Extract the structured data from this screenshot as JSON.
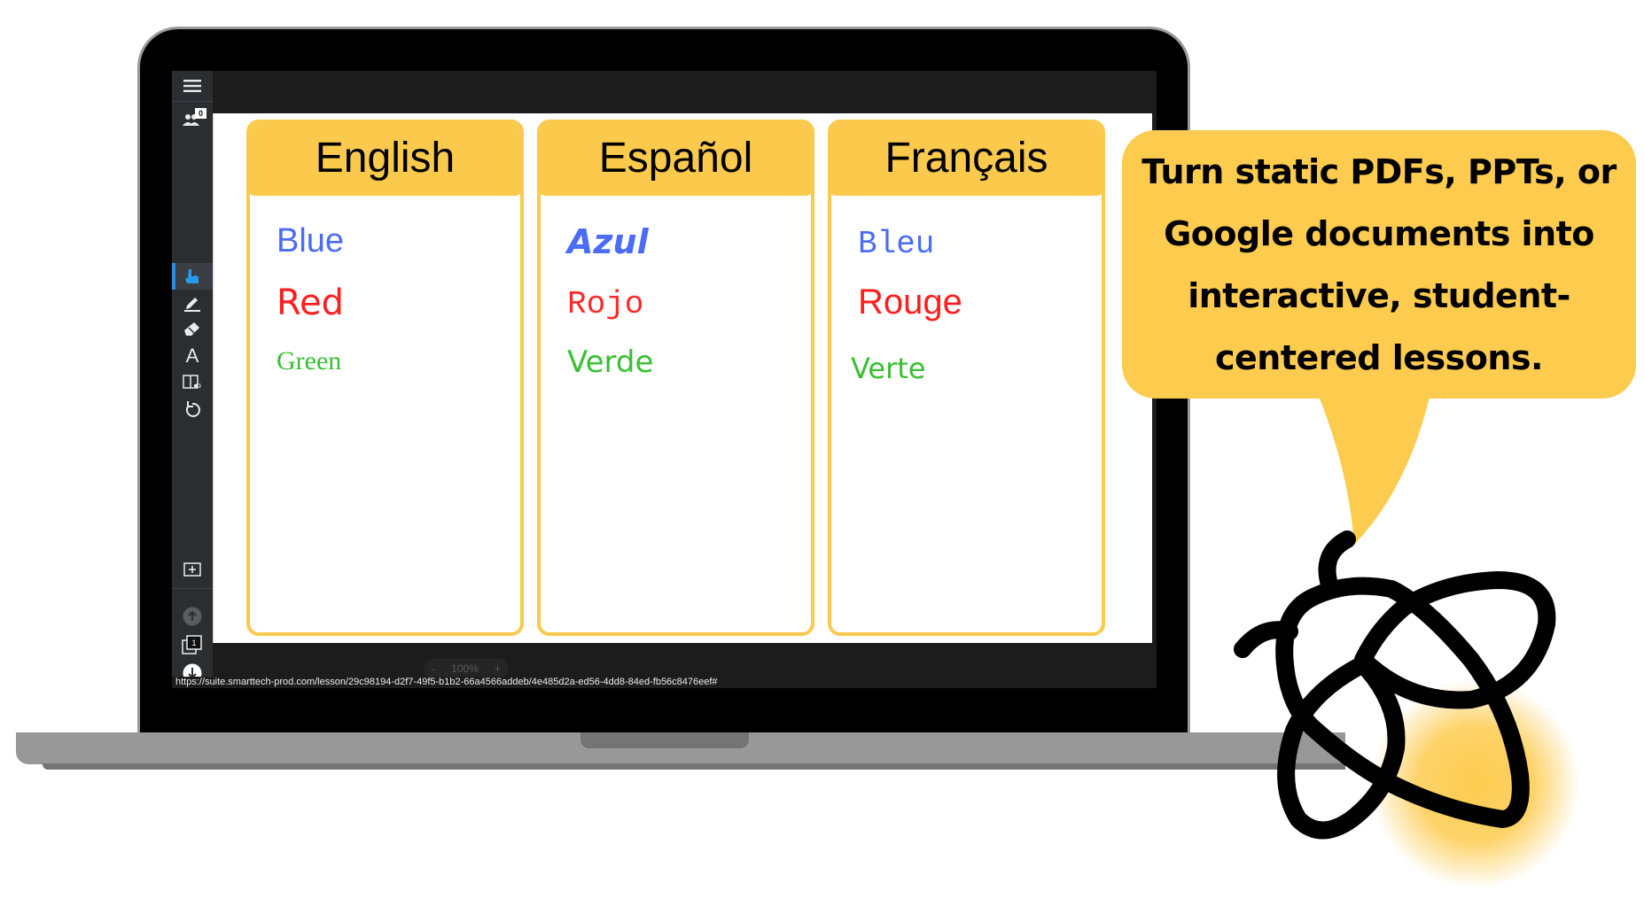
{
  "sidebar": {
    "participants_count": "0",
    "page_number": "1",
    "icons": [
      "menu-icon",
      "participants-icon",
      "select-hand-icon",
      "pen-icon",
      "eraser-icon",
      "text-icon",
      "read-aloud-icon",
      "undo-icon",
      "add-page-icon",
      "previous-page-icon",
      "pages-icon",
      "next-page-icon"
    ],
    "active_tool": "select-hand-icon",
    "active_color": "#2a8fe0"
  },
  "canvas": {
    "cards": [
      {
        "title": "English",
        "words": [
          {
            "text": "Blue",
            "color": "#4a6cf7"
          },
          {
            "text": "Red",
            "color": "#ff1f1f"
          },
          {
            "text": "Green",
            "color": "#39c032"
          }
        ]
      },
      {
        "title": "Español",
        "words": [
          {
            "text": "Azul",
            "color": "#4a6cf7"
          },
          {
            "text": "Rojo",
            "color": "#ff2a2a"
          },
          {
            "text": "Verde",
            "color": "#39c032"
          }
        ]
      },
      {
        "title": "Français",
        "words": [
          {
            "text": "Bleu",
            "color": "#4a6cf7"
          },
          {
            "text": "Rouge",
            "color": "#ff1f1f"
          },
          {
            "text": "Verte",
            "color": "#39c032"
          }
        ]
      }
    ],
    "card_color": "#fbc94c"
  },
  "zoom": {
    "minus": "-",
    "value": "100%",
    "plus": "+"
  },
  "status_url": "https://suite.smarttech-prod.com/lesson/29c98194-d2f7-49f5-b1b2-66a4566addeb/4e485d2a-ed56-4dd8-84ed-fb56c8476eef#",
  "bubble": {
    "text": "Turn static PDFs, PPTs, or Google documents into interactive, student-centered lessons.",
    "color": "#fdcb4e"
  },
  "mascot": {
    "name": "bee-logo-icon",
    "glow_color": "#fdcb4e"
  }
}
